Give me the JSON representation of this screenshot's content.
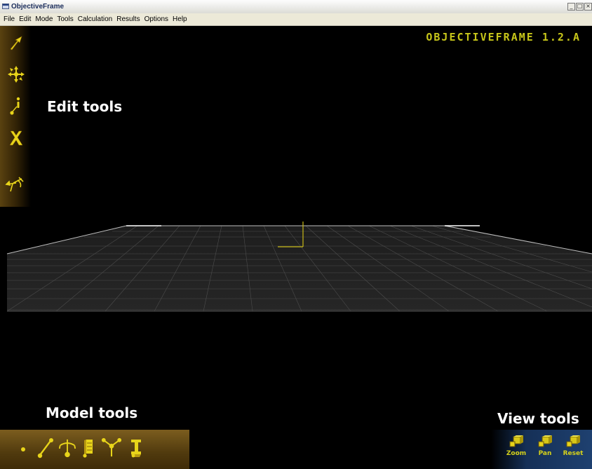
{
  "window": {
    "title": "ObjectiveFrame",
    "controls": [
      "_",
      "□",
      "×"
    ]
  },
  "menu": [
    "File",
    "Edit",
    "Mode",
    "Tools",
    "Calculation",
    "Results",
    "Options",
    "Help"
  ],
  "brand": "OBJECTIVEFRAME 1.2.A",
  "panels": {
    "edit": {
      "caption": "Edit tools",
      "tools": [
        "select-arrow-icon",
        "move-icon",
        "inspect-icon",
        "delete-icon",
        "feedback-icon"
      ]
    },
    "model": {
      "caption": "Model tools",
      "tools": [
        "node-icon",
        "beam-icon",
        "node-load-icon",
        "beam-load-icon",
        "node-bc-icon",
        "materials-icon"
      ]
    },
    "view": {
      "caption": "View tools",
      "buttons": [
        {
          "label": "Zoom",
          "icon": "zoom-icon"
        },
        {
          "label": "Pan",
          "icon": "pan-icon"
        },
        {
          "label": "Reset",
          "icon": "reset-icon"
        }
      ]
    }
  },
  "colors": {
    "accent": "#c7c61a",
    "icon": "#e8d41a",
    "grid": "#3b3b3b",
    "background": "#000000"
  }
}
